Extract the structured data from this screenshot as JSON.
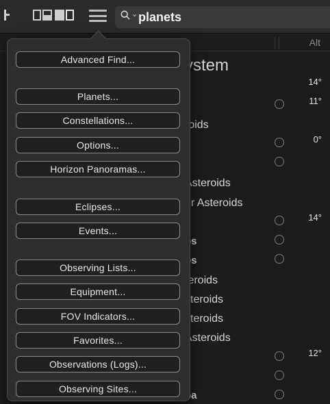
{
  "search": {
    "value": "planets"
  },
  "columns": {
    "alt": "Alt"
  },
  "background": {
    "labels": [
      "ystem",
      "roids",
      "Asteroids",
      "er Asteroids",
      "os",
      "os",
      "teroids",
      "steroids",
      "steroids",
      "Asteroids",
      "pa"
    ],
    "alts": [
      "14°",
      "11°",
      "0°",
      "14°",
      "12°"
    ]
  },
  "menu": {
    "items": [
      "Advanced Find...",
      "Planets...",
      "Constellations...",
      "Options...",
      "Horizon Panoramas...",
      "Eclipses...",
      "Events...",
      "Observing Lists...",
      "Equipment...",
      "FOV Indicators...",
      "Favorites...",
      "Observations (Logs)...",
      "Observing Sites..."
    ]
  },
  "colors": {
    "background": "#1c1c1e",
    "popover": "#2e2e30",
    "button_border": "#8a8a8c"
  }
}
